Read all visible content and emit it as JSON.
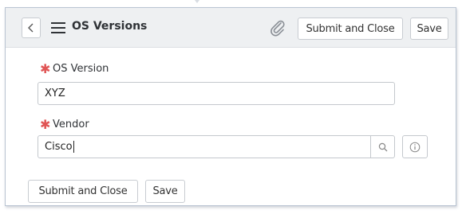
{
  "header": {
    "title": "OS Versions",
    "submit_label": "Submit and Close",
    "save_label": "Save"
  },
  "icons": {
    "back": "chevron-left-icon",
    "menu": "hamburger-menu-icon",
    "attach": "paperclip-icon",
    "search": "search-icon",
    "info": "info-icon"
  },
  "form": {
    "os_version": {
      "label": "OS Version",
      "required": true,
      "value": "XYZ"
    },
    "vendor": {
      "label": "Vendor",
      "required": true,
      "value": "Cisco"
    }
  },
  "footer": {
    "submit_label": "Submit and Close",
    "save_label": "Save"
  },
  "colors": {
    "required_star": "#e05555",
    "header_bg": "#eef0f2",
    "border": "#c4c8cd"
  }
}
